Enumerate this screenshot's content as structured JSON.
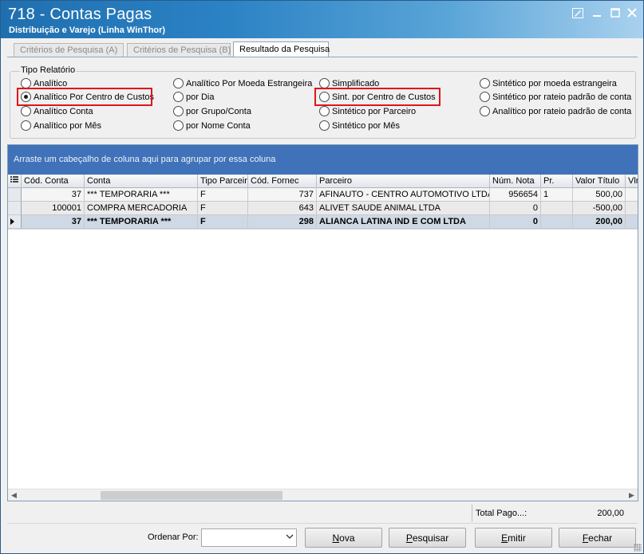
{
  "window": {
    "title": "718 - Contas Pagas",
    "subtitle": "Distribuição e Varejo (Linha WinThor)"
  },
  "tabs": [
    {
      "label": "Critérios de Pesquisa (A)"
    },
    {
      "label": "Critérios de Pesquisa (B)"
    },
    {
      "label": "Resultado da Pesquisa"
    }
  ],
  "report_type": {
    "legend": "Tipo Relatório",
    "options": [
      {
        "label": "Analítico"
      },
      {
        "label": "Analítico Por Centro de Custos",
        "selected": true
      },
      {
        "label": "Analítico Conta"
      },
      {
        "label": "Analítico por Mês"
      },
      {
        "label": "Analítico Por Moeda Estrangeira"
      },
      {
        "label": "por Dia"
      },
      {
        "label": "por Grupo/Conta"
      },
      {
        "label": "por Nome Conta"
      },
      {
        "label": "Simplificado"
      },
      {
        "label": "Sint. por Centro de Custos"
      },
      {
        "label": "Sintético por Parceiro"
      },
      {
        "label": "Sintético por Mês"
      },
      {
        "label": "Sintético por moeda estrangeira"
      },
      {
        "label": "Sintético por rateio padrão de conta"
      },
      {
        "label": "Analítico por rateio padrão de conta"
      }
    ]
  },
  "grid": {
    "group_hint": "Arraste um cabeçalho de coluna aqui para agrupar por essa coluna",
    "columns": [
      "Cód. Conta",
      "Conta",
      "Tipo Parceiro",
      "Cód. Fornec",
      "Parceiro",
      "Núm. Nota",
      "Pr.",
      "Valor Título",
      "Vlr."
    ],
    "rows": [
      {
        "cod_conta": "37",
        "conta": "*** TEMPORARIA ***",
        "tipo": "F",
        "cod_fornec": "737",
        "parceiro": "AFINAUTO - CENTRO AUTOMOTIVO LTDA",
        "nota": "956654",
        "pr": "1",
        "valor": "500,00"
      },
      {
        "cod_conta": "100001",
        "conta": "COMPRA MERCADORIA",
        "tipo": "F",
        "cod_fornec": "643",
        "parceiro": "ALIVET SAUDE ANIMAL LTDA",
        "nota": "0",
        "pr": "",
        "valor": "-500,00"
      },
      {
        "cod_conta": "37",
        "conta": "*** TEMPORARIA ***",
        "tipo": "F",
        "cod_fornec": "298",
        "parceiro": "ALIANCA LATINA IND E COM LTDA",
        "nota": "0",
        "pr": "",
        "valor": "200,00"
      }
    ]
  },
  "totals": {
    "label": "Total Pago...:",
    "value": "200,00"
  },
  "footer": {
    "order_label": "Ordenar Por:",
    "order_value": "",
    "buttons": {
      "nova": "Nova",
      "pesquisar": "Pesquisar",
      "emitir": "Emitir",
      "fechar": "Fechar"
    }
  },
  "colors": {
    "title_bar": "#2b82c4",
    "group_band": "#3f72b8",
    "highlight": "#e0151b"
  }
}
